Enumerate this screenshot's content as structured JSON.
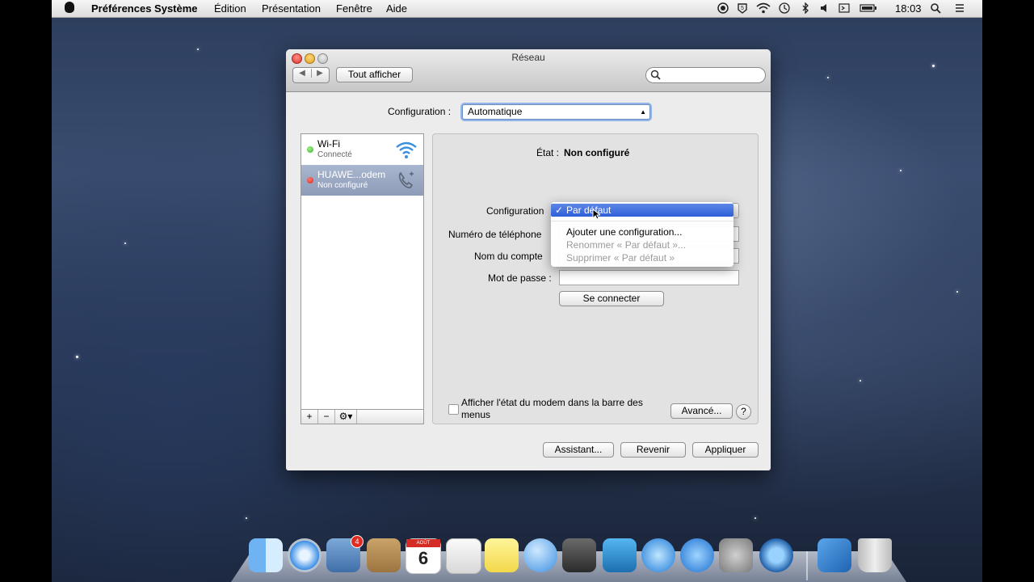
{
  "menubar": {
    "app_name": "Préférences Système",
    "menus": [
      "Édition",
      "Présentation",
      "Fenêtre",
      "Aide"
    ],
    "clock": "18:03",
    "status_icons": [
      "record-icon",
      "s5-icon",
      "wifi-icon",
      "time-machine-icon",
      "bluetooth-icon",
      "volume-icon",
      "input-icon",
      "battery-icon",
      "spotlight-icon",
      "list-icon"
    ]
  },
  "window": {
    "title": "Réseau",
    "show_all_label": "Tout afficher",
    "location_label": "Configuration :",
    "location_value": "Automatique",
    "services": [
      {
        "name": "Wi-Fi",
        "status": "Connecté",
        "dot_color": "#3fb52f",
        "icon": "wifi-icon"
      },
      {
        "name": "HUAWE...odem",
        "status": "Non configuré",
        "dot_color": "#d8261e",
        "icon": "phone-icon"
      }
    ],
    "sidebar_buttons": {
      "add": "+",
      "remove": "−"
    },
    "detail": {
      "status_label": "État :",
      "status_value": "Non configuré",
      "configuration_label": "Configuration",
      "phone_label": "Numéro de téléphone",
      "account_label": "Nom du compte",
      "password_label": "Mot de passe :",
      "connect_button": "Se connecter",
      "show_status_checkbox": "Afficher l'état du modem dans la barre des menus",
      "advanced_button": "Avancé...",
      "help_button": "?"
    },
    "config_menu": {
      "selected": "Par défaut",
      "checkmark": "✓",
      "items": [
        {
          "label": "Ajouter une configuration...",
          "enabled": true
        },
        {
          "label": "Renommer « Par défaut »...",
          "enabled": false
        },
        {
          "label": "Supprimer « Par défaut »",
          "enabled": false
        }
      ]
    },
    "bottom_buttons": {
      "assistant": "Assistant...",
      "revert": "Revenir",
      "apply": "Appliquer"
    }
  },
  "dock": {
    "items": [
      "Finder",
      "Safari",
      "Courrier",
      "Contacts",
      "Calendrier",
      "Rappels",
      "Notes",
      "Messages",
      "FaceTime",
      "Photo Booth",
      "iTunes",
      "App Store",
      "Préférences Système",
      "QuickTime Player",
      "VMware",
      "Corbeille"
    ],
    "mail_badge": "4",
    "calendar_month": "AOÛT",
    "calendar_day": "6"
  }
}
